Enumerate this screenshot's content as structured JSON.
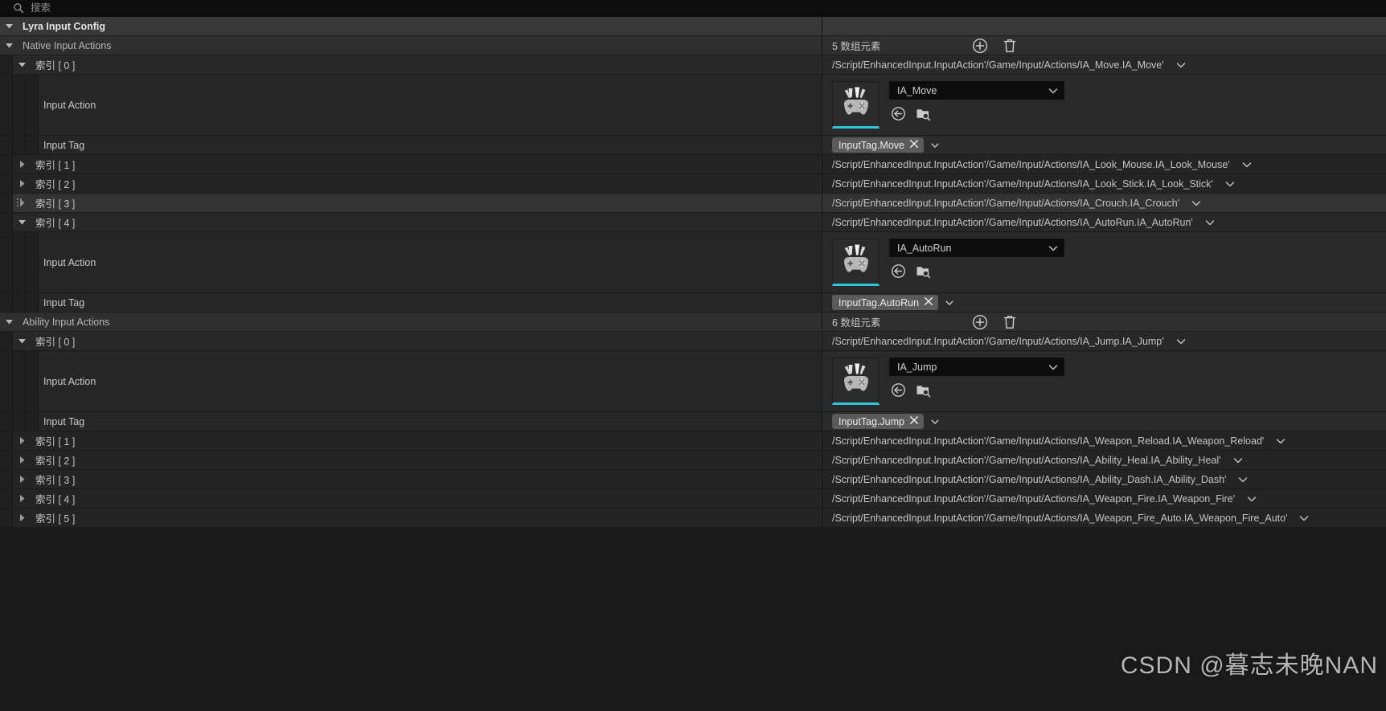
{
  "search": {
    "placeholder": "搜索",
    "value": "",
    "icon": "search-icon"
  },
  "root": {
    "label": "Lyra Input Config"
  },
  "sections": [
    {
      "label": "Native Input Actions",
      "count_label": "5 数组元素",
      "add_icon": "plus-circle-icon",
      "delete_icon": "trash-icon",
      "items": [
        {
          "index_label": "索引 [ 0 ]",
          "path": "/Script/EnhancedInput.InputAction'/Game/Input/Actions/IA_Move.IA_Move'",
          "expanded": true,
          "hovered": false,
          "properties": {
            "input_action_label": "Input Action",
            "input_action_value": "IA_Move",
            "input_tag_label": "Input Tag",
            "input_tag_value": "InputTag.Move"
          }
        },
        {
          "index_label": "索引 [ 1 ]",
          "path": "/Script/EnhancedInput.InputAction'/Game/Input/Actions/IA_Look_Mouse.IA_Look_Mouse'",
          "expanded": false,
          "hovered": false
        },
        {
          "index_label": "索引 [ 2 ]",
          "path": "/Script/EnhancedInput.InputAction'/Game/Input/Actions/IA_Look_Stick.IA_Look_Stick'",
          "expanded": false,
          "hovered": false
        },
        {
          "index_label": "索引 [ 3 ]",
          "path": "/Script/EnhancedInput.InputAction'/Game/Input/Actions/IA_Crouch.IA_Crouch'",
          "expanded": false,
          "hovered": true
        },
        {
          "index_label": "索引 [ 4 ]",
          "path": "/Script/EnhancedInput.InputAction'/Game/Input/Actions/IA_AutoRun.IA_AutoRun'",
          "expanded": true,
          "hovered": false,
          "properties": {
            "input_action_label": "Input Action",
            "input_action_value": "IA_AutoRun",
            "input_tag_label": "Input Tag",
            "input_tag_value": "InputTag.AutoRun"
          }
        }
      ]
    },
    {
      "label": "Ability Input Actions",
      "count_label": "6 数组元素",
      "add_icon": "plus-circle-icon",
      "delete_icon": "trash-icon",
      "items": [
        {
          "index_label": "索引 [ 0 ]",
          "path": "/Script/EnhancedInput.InputAction'/Game/Input/Actions/IA_Jump.IA_Jump'",
          "expanded": true,
          "hovered": false,
          "properties": {
            "input_action_label": "Input Action",
            "input_action_value": "IA_Jump",
            "input_tag_label": "Input Tag",
            "input_tag_value": "InputTag.Jump"
          }
        },
        {
          "index_label": "索引 [ 1 ]",
          "path": "/Script/EnhancedInput.InputAction'/Game/Input/Actions/IA_Weapon_Reload.IA_Weapon_Reload'",
          "expanded": false,
          "hovered": false
        },
        {
          "index_label": "索引 [ 2 ]",
          "path": "/Script/EnhancedInput.InputAction'/Game/Input/Actions/IA_Ability_Heal.IA_Ability_Heal'",
          "expanded": false,
          "hovered": false
        },
        {
          "index_label": "索引 [ 3 ]",
          "path": "/Script/EnhancedInput.InputAction'/Game/Input/Actions/IA_Ability_Dash.IA_Ability_Dash'",
          "expanded": false,
          "hovered": false
        },
        {
          "index_label": "索引 [ 4 ]",
          "path": "/Script/EnhancedInput.InputAction'/Game/Input/Actions/IA_Weapon_Fire.IA_Weapon_Fire'",
          "expanded": false,
          "hovered": false
        },
        {
          "index_label": "索引 [ 5 ]",
          "path": "/Script/EnhancedInput.InputAction'/Game/Input/Actions/IA_Weapon_Fire_Auto.IA_Weapon_Fire_Auto'",
          "expanded": false,
          "hovered": false
        }
      ]
    }
  ],
  "icons": {
    "thumbnail": "input-action-gamepad-icon",
    "use_selected": "use-selected-asset-icon",
    "browse": "browse-to-asset-icon",
    "clear_tag": "clear-tag-x-icon",
    "dropdown": "chevron-down-icon"
  },
  "accent_color": "#2cc6d8",
  "watermark": "CSDN @暮志未晚NAN"
}
